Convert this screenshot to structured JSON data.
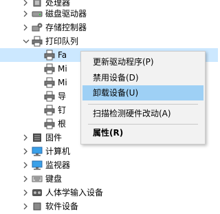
{
  "tree": {
    "items": [
      {
        "label": "处理器",
        "icon": "processor-icon"
      },
      {
        "label": "磁盘驱动器",
        "icon": "disk-drive-icon"
      },
      {
        "label": "存储控制器",
        "icon": "storage-controller-icon"
      },
      {
        "label": "打印队列",
        "icon": "printer-icon"
      },
      {
        "label": "Fa",
        "icon": "printer-icon"
      },
      {
        "label": "Mi",
        "icon": "printer-icon"
      },
      {
        "label": "Mi",
        "icon": "printer-icon"
      },
      {
        "label": "导",
        "icon": "printer-icon"
      },
      {
        "label": "钉",
        "icon": "printer-icon"
      },
      {
        "label": "根",
        "icon": "printer-icon"
      },
      {
        "label": "固件",
        "icon": "firmware-icon"
      },
      {
        "label": "计算机",
        "icon": "computer-icon"
      },
      {
        "label": "监视器",
        "icon": "monitor-icon"
      },
      {
        "label": "键盘",
        "icon": "keyboard-icon"
      },
      {
        "label": "人体学输入设备",
        "icon": "hid-icon"
      },
      {
        "label": "软件设备",
        "icon": "software-device-icon"
      }
    ]
  },
  "context_menu": {
    "update_driver": "更新驱动程序(P)",
    "disable_device": "禁用设备(D)",
    "uninstall_device": "卸载设备(U)",
    "scan_hardware": "扫描检测硬件改动(A)",
    "properties": "属性(R)"
  }
}
